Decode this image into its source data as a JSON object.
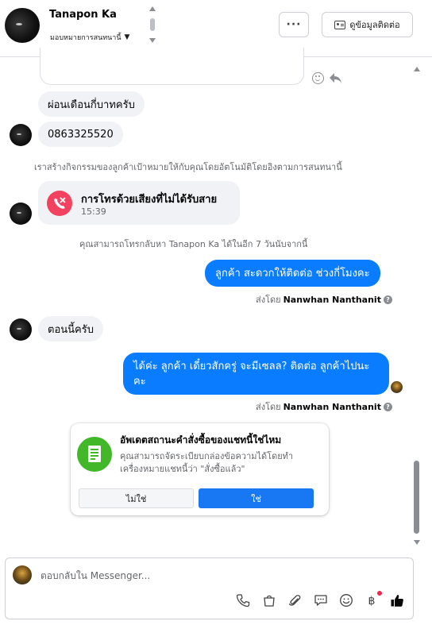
{
  "header": {
    "contact_name": "Tanapon Ka",
    "assign_label": "มอบหมายการสนทนานี้",
    "more_label": "···",
    "view_contact_label": "ดูข้อมูลติดต่อ"
  },
  "messages": {
    "msg1": "ผ่อนเดือนกี่บาทครับ",
    "msg2": "0863325520",
    "system1": "เราสร้างกิจกรรมของลูกค้าเป้าหมายให้กับคุณโดยอัตโนมัติโดยอิงตามการสนทนานี้",
    "call_title": "การโทรด้วยเสียงที่ไม่ได้รับสาย",
    "call_time": "15:39",
    "system2": "คุณสามารถโทรกลับหา Tanapon Ka ได้ในอีก 7 วันนับจากนี้",
    "out1": "ลูกค้า สะดวกให้ติดต่อ ช่วงกี่โมงคะ",
    "sent_by_label": "ส่งโดย",
    "sender_name": "Nanwhan Nanthanit",
    "msg3": "ตอนนี้ครับ",
    "out2_line1": "ได้ค่ะ ลูกค้า เดี๋ยวสักครู่ จะมีเซลล",
    "out2_line2": "? ติดต่อ ลูกค้าไปนะ",
    "out2_line3": "คะ"
  },
  "order_card": {
    "title": "อัพเดตสถานะคำสั่งซื้อของแชทนี้ใช่ไหม",
    "desc_line1": "คุณสามารถจัดระเบียบกล่องข้อความได้โดยทำ",
    "desc_line2": "เครื่องหมายแชทนี้ว่า \"สั่งซื้อแล้ว\"",
    "no_label": "ไม่ใช่",
    "yes_label": "ใช่"
  },
  "composer": {
    "placeholder": "ตอบกลับใน Messenger...",
    "icons": [
      "phone-icon",
      "shopping-bag-icon",
      "attachment-icon",
      "saved-replies-icon",
      "emoji-icon",
      "baht-icon",
      "like-icon"
    ]
  },
  "colors": {
    "outgoing_bubble": "#0a7cff",
    "incoming_bubble": "#f0f2f5",
    "missed_call": "#f3425f",
    "order_icon": "#42b72a",
    "primary_button": "#1877f2"
  }
}
